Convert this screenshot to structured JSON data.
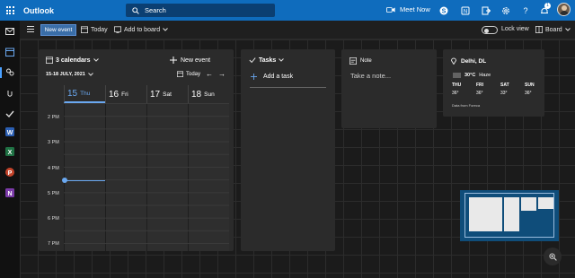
{
  "app": {
    "title": "Outlook"
  },
  "search": {
    "placeholder": "Search"
  },
  "topbar": {
    "meet_now": "Meet Now",
    "notification_count": "1",
    "icons": [
      "waffle-icon",
      "video-icon",
      "skype-icon",
      "onenote-icon",
      "send-icon",
      "gear-icon",
      "help-icon",
      "bell-icon"
    ]
  },
  "rail": {
    "items": [
      "mail-icon",
      "calendar-icon",
      "people-icon",
      "attach-icon",
      "todo-icon",
      "word-icon",
      "excel-icon",
      "powerpoint-icon",
      "onenote-icon"
    ]
  },
  "toolbar": {
    "new_event": "New event",
    "today": "Today",
    "add_to_board": "Add to board",
    "lock_view": "Lock view",
    "board": "Board"
  },
  "calendar": {
    "calendars_label": "3 calendars",
    "new_event": "New event",
    "range": "15-18 JULY, 2021",
    "today": "Today",
    "days": [
      {
        "num": "15",
        "name": "Thu"
      },
      {
        "num": "16",
        "name": "Fri"
      },
      {
        "num": "17",
        "name": "Sat"
      },
      {
        "num": "18",
        "name": "Sun"
      }
    ],
    "hours": [
      "2 PM",
      "3 PM",
      "4 PM",
      "5 PM",
      "6 PM",
      "7 PM"
    ]
  },
  "tasks": {
    "title": "Tasks",
    "add_task": "Add a task"
  },
  "note": {
    "title": "Note",
    "placeholder": "Take a note..."
  },
  "weather": {
    "location": "Delhi, DL",
    "current_temp": "30°C",
    "current_condition": "Haze",
    "days": [
      {
        "name": "THU",
        "temp": "36°"
      },
      {
        "name": "FRI",
        "temp": "36°"
      },
      {
        "name": "SAT",
        "temp": "33°"
      },
      {
        "name": "SUN",
        "temp": "36°"
      }
    ],
    "source": "Data from Foreca"
  },
  "colors": {
    "brand": "#0f6cbd",
    "accent": "#6aa8f0",
    "card": "#2b2b2b"
  }
}
